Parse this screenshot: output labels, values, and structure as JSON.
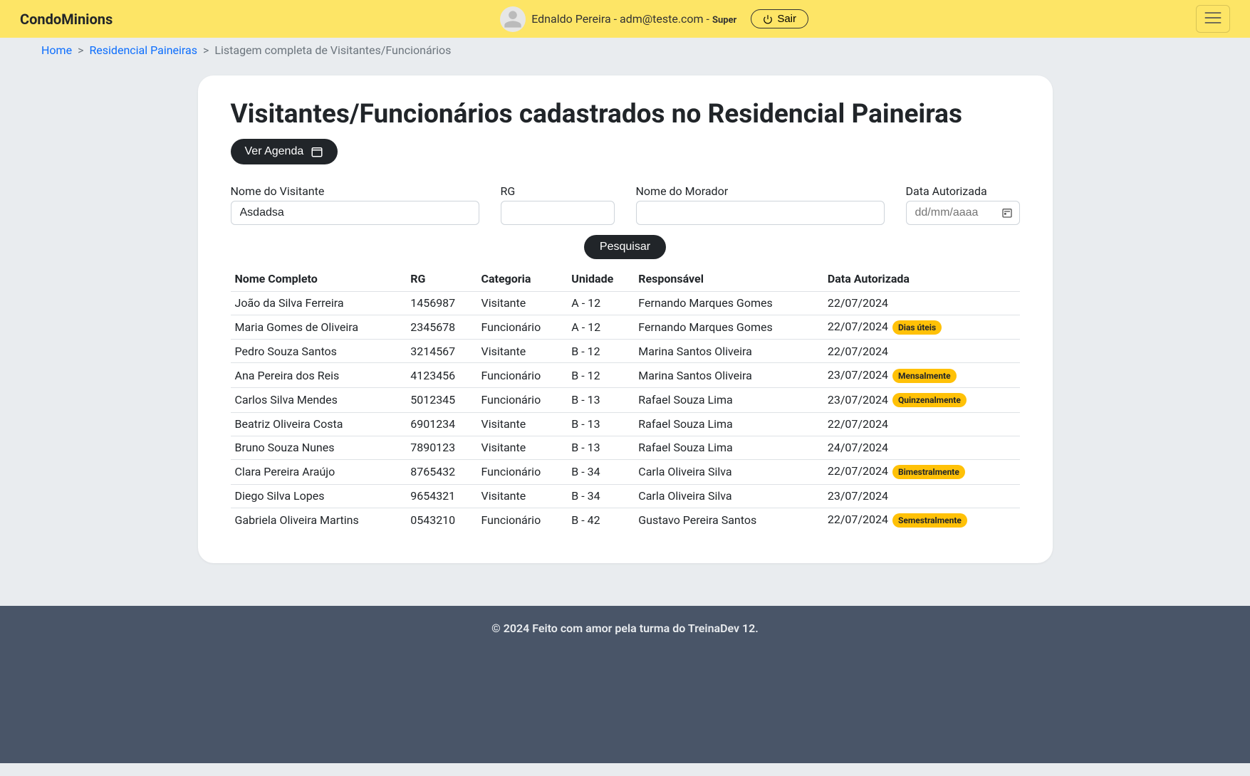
{
  "navbar": {
    "brand": "CondoMinions",
    "user_display": "Ednaldo Pereira - adm@teste.com",
    "role_separator": " - ",
    "role": "Super",
    "logout_label": "Sair"
  },
  "breadcrumb": {
    "items": [
      {
        "label": "Home",
        "link": true
      },
      {
        "label": "Residencial Paineiras",
        "link": true
      },
      {
        "label": "Listagem completa de Visitantes/Funcionários",
        "link": false
      }
    ]
  },
  "page": {
    "title": "Visitantes/Funcionários cadastrados no Residencial Paineiras",
    "agenda_button": "Ver Agenda"
  },
  "form": {
    "visitor_name_label": "Nome do Visitante",
    "visitor_name_value": "Asdadsa",
    "rg_label": "RG",
    "rg_value": "",
    "resident_name_label": "Nome do Morador",
    "resident_name_value": "",
    "date_label": "Data Autorizada",
    "date_placeholder": "dd/mm/aaaa",
    "date_value": "",
    "search_button": "Pesquisar"
  },
  "table": {
    "headers": {
      "name": "Nome Completo",
      "rg": "RG",
      "category": "Categoria",
      "unit": "Unidade",
      "responsible": "Responsável",
      "date": "Data Autorizada"
    },
    "rows": [
      {
        "name": "João da Silva Ferreira",
        "rg": "1456987",
        "category": "Visitante",
        "unit": "A - 12",
        "responsible": "Fernando Marques Gomes",
        "date": "22/07/2024",
        "badge": ""
      },
      {
        "name": "Maria Gomes de Oliveira",
        "rg": "2345678",
        "category": "Funcionário",
        "unit": "A - 12",
        "responsible": "Fernando Marques Gomes",
        "date": "22/07/2024",
        "badge": "Dias úteis"
      },
      {
        "name": "Pedro Souza Santos",
        "rg": "3214567",
        "category": "Visitante",
        "unit": "B - 12",
        "responsible": "Marina Santos Oliveira",
        "date": "22/07/2024",
        "badge": ""
      },
      {
        "name": "Ana Pereira dos Reis",
        "rg": "4123456",
        "category": "Funcionário",
        "unit": "B - 12",
        "responsible": "Marina Santos Oliveira",
        "date": "23/07/2024",
        "badge": "Mensalmente"
      },
      {
        "name": "Carlos Silva Mendes",
        "rg": "5012345",
        "category": "Funcionário",
        "unit": "B - 13",
        "responsible": "Rafael Souza Lima",
        "date": "23/07/2024",
        "badge": "Quinzenalmente"
      },
      {
        "name": "Beatriz Oliveira Costa",
        "rg": "6901234",
        "category": "Visitante",
        "unit": "B - 13",
        "responsible": "Rafael Souza Lima",
        "date": "22/07/2024",
        "badge": ""
      },
      {
        "name": "Bruno Souza Nunes",
        "rg": "7890123",
        "category": "Visitante",
        "unit": "B - 13",
        "responsible": "Rafael Souza Lima",
        "date": "24/07/2024",
        "badge": ""
      },
      {
        "name": "Clara Pereira Araújo",
        "rg": "8765432",
        "category": "Funcionário",
        "unit": "B - 34",
        "responsible": "Carla Oliveira Silva",
        "date": "22/07/2024",
        "badge": "Bimestralmente"
      },
      {
        "name": "Diego Silva Lopes",
        "rg": "9654321",
        "category": "Visitante",
        "unit": "B - 34",
        "responsible": "Carla Oliveira Silva",
        "date": "23/07/2024",
        "badge": ""
      },
      {
        "name": "Gabriela Oliveira Martins",
        "rg": "0543210",
        "category": "Funcionário",
        "unit": "B - 42",
        "responsible": "Gustavo Pereira Santos",
        "date": "22/07/2024",
        "badge": "Semestralmente"
      }
    ]
  },
  "footer": {
    "text": "© 2024 Feito com amor pela turma do TreinaDev 12."
  }
}
